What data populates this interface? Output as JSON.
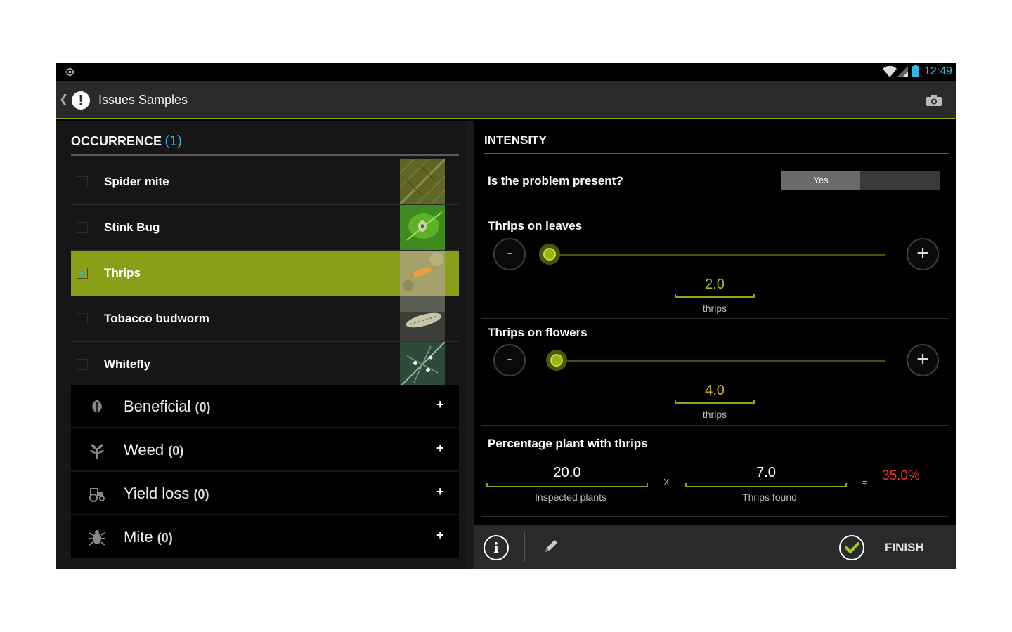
{
  "status_bar": {
    "time": "12:49"
  },
  "action_bar": {
    "title": "Issues Samples"
  },
  "occurrence": {
    "label": "OCCURRENCE",
    "count": "(1)",
    "items": [
      {
        "name": "Spider mite",
        "checked": false
      },
      {
        "name": "Stink Bug",
        "checked": false
      },
      {
        "name": "Thrips",
        "checked": true
      },
      {
        "name": "Tobacco budworm",
        "checked": false
      },
      {
        "name": "Whitefly",
        "checked": false
      }
    ]
  },
  "categories": [
    {
      "name": "Beneficial",
      "count": "(0)",
      "icon": "leaf-icon"
    },
    {
      "name": "Weed",
      "count": "(0)",
      "icon": "weed-icon"
    },
    {
      "name": "Yield loss",
      "count": "(0)",
      "icon": "tractor-icon"
    },
    {
      "name": "Mite",
      "count": "(0)",
      "icon": "bug-icon"
    }
  ],
  "category_plus": "+",
  "intensity": {
    "header": "INTENSITY",
    "present_question": "Is the problem present?",
    "present_value": "Yes",
    "leaves": {
      "label": "Thrips on leaves",
      "value": "2.0",
      "unit": "thrips",
      "value_color": "#9ccc1e",
      "minus": "-",
      "plus": "+"
    },
    "flowers": {
      "label": "Thrips on flowers",
      "value": "4.0",
      "unit": "thrips",
      "value_color": "#c8b220",
      "minus": "-",
      "plus": "+"
    },
    "percentage": {
      "label": "Percentage plant with thrips",
      "inspected_value": "20.0",
      "inspected_label": "Inspected plants",
      "times": "X",
      "found_value": "7.0",
      "found_label": "Thrips found",
      "equals": "=",
      "result": "35.0%",
      "result_color": "#e53935"
    }
  },
  "bottom_bar": {
    "finish": "FINISH"
  },
  "colors": {
    "accent": "#8fa31a",
    "highlight": "#33b5e5"
  }
}
